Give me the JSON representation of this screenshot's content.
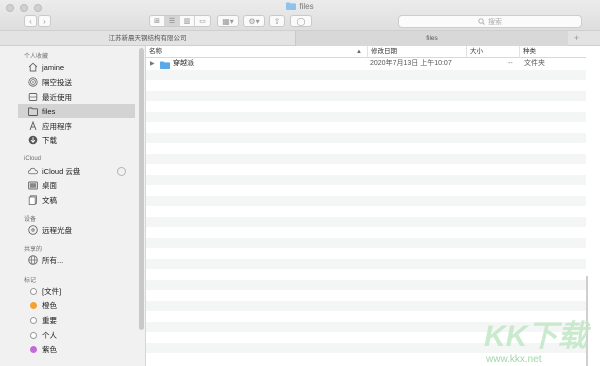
{
  "window": {
    "title": "files"
  },
  "toolbar": {
    "back": "‹",
    "forward": "›",
    "search_placeholder": "搜索"
  },
  "tabs": [
    {
      "label": "江苏新晨天钢结构有限公司"
    },
    {
      "label": "files"
    }
  ],
  "tab_add": "+",
  "sidebar": {
    "sections": {
      "favorites": "个人收藏",
      "icloud": "iCloud",
      "devices": "设备",
      "shared": "共享的",
      "tags": "标记"
    },
    "favorites": [
      {
        "label": "jamine",
        "icon": "home-icon"
      },
      {
        "label": "隔空投送",
        "icon": "airdrop-icon"
      },
      {
        "label": "最近使用",
        "icon": "recents-icon"
      },
      {
        "label": "files",
        "icon": "folder-icon",
        "selected": true
      },
      {
        "label": "应用程序",
        "icon": "applications-icon"
      },
      {
        "label": "下载",
        "icon": "downloads-icon"
      }
    ],
    "icloud": [
      {
        "label": "iCloud 云盘",
        "icon": "cloud-icon"
      },
      {
        "label": "桌面",
        "icon": "desktop-icon"
      },
      {
        "label": "文稿",
        "icon": "documents-icon"
      }
    ],
    "devices": [
      {
        "label": "远程光盘",
        "icon": "disc-icon"
      }
    ],
    "shared": [
      {
        "label": "所有...",
        "icon": "network-icon"
      }
    ],
    "tags": [
      {
        "label": "[文件]",
        "color": "hollow"
      },
      {
        "label": "橙色",
        "color": "#f5a030"
      },
      {
        "label": "重要",
        "color": "hollow"
      },
      {
        "label": "个人",
        "color": "hollow"
      },
      {
        "label": "紫色",
        "color": "#c46ad8"
      }
    ]
  },
  "columns": {
    "name": "名称",
    "modified": "修改日期",
    "size": "大小",
    "kind": "种类"
  },
  "files": [
    {
      "name": "穿越派",
      "modified": "2020年7月13日 上午10:07",
      "size": "--",
      "kind": "文件夹"
    }
  ],
  "colors": {
    "folder_blue": "#5aa9e6",
    "selection": "#d3d3d3",
    "stripe": "#f4f5f5"
  },
  "watermark": {
    "text": "KK下载",
    "url": "www.kkx.net"
  }
}
